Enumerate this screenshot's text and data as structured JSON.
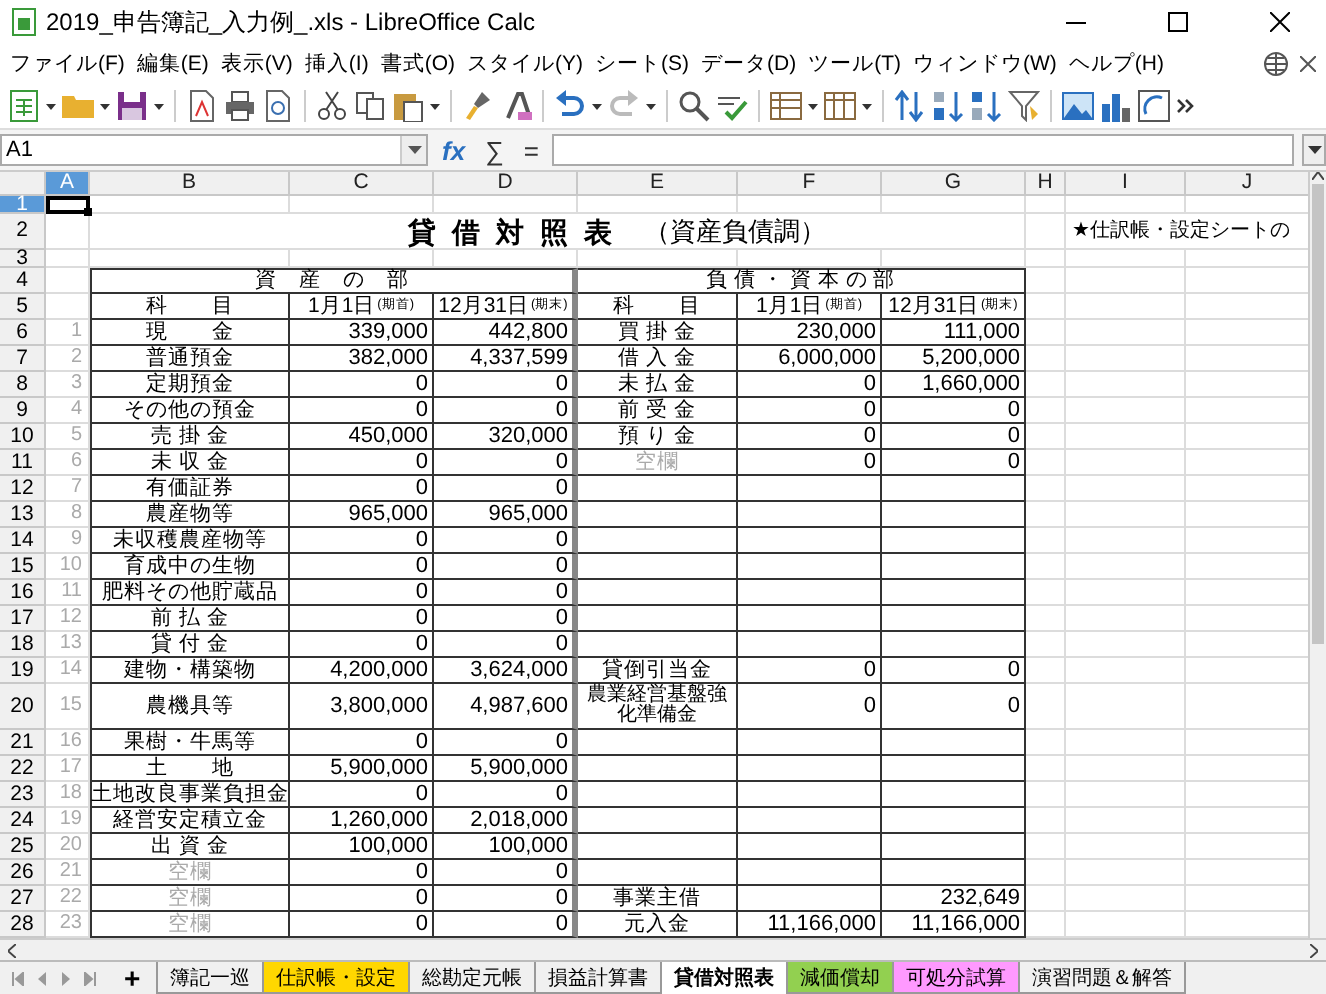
{
  "window": {
    "title": "2019_申告簿記_入力例_.xls - LibreOffice Calc"
  },
  "menu": [
    "ファイル(F)",
    "編集(E)",
    "表示(V)",
    "挿入(I)",
    "書式(O)",
    "スタイル(Y)",
    "シート(S)",
    "データ(D)",
    "ツール(T)",
    "ウィンドウ(W)",
    "ヘルプ(H)"
  ],
  "formula_bar": {
    "cell_ref": "A1",
    "symbols": [
      "fx",
      "∑",
      "="
    ]
  },
  "columns": [
    {
      "label": "A",
      "selected": true
    },
    {
      "label": "B",
      "selected": false
    },
    {
      "label": "C",
      "selected": false
    },
    {
      "label": "D",
      "selected": false
    },
    {
      "label": "E",
      "selected": false
    },
    {
      "label": "F",
      "selected": false
    },
    {
      "label": "G",
      "selected": false
    },
    {
      "label": "H",
      "selected": false
    },
    {
      "label": "I",
      "selected": false
    },
    {
      "label": "J",
      "selected": false
    }
  ],
  "rows": [
    {
      "kind": "blank",
      "row": "1",
      "selected": true
    },
    {
      "kind": "title",
      "row": "2",
      "selected": false,
      "title": "貸 借 対 照 表",
      "subtitle": "（資産負債調）",
      "note": "★仕訳帳・設定シートの"
    },
    {
      "kind": "blank",
      "row": "3",
      "selected": false
    },
    {
      "kind": "section",
      "row": "4",
      "selected": false,
      "assets": "資　産　の　部",
      "liabilities": "負 債 ・ 資 本 の 部"
    },
    {
      "kind": "header",
      "row": "5",
      "selected": false,
      "headers": [
        {
          "label": "科　　目"
        },
        {
          "label": "1月1日",
          "note": "(期首)"
        },
        {
          "label": "12月31日",
          "note": "(期末)"
        },
        {
          "label": "科　　目"
        },
        {
          "label": "1月1日",
          "note": "(期首)"
        },
        {
          "label": "12月31日",
          "note": "(期末)"
        }
      ]
    },
    {
      "kind": "entry",
      "row": "6",
      "selected": false,
      "index": "1",
      "asset": {
        "label": "現　　金",
        "muted": false
      },
      "opening": "339,000",
      "closing": "442,800",
      "liability": {
        "label": "買 掛 金",
        "muted": false
      },
      "liability_opening": "230,000",
      "liability_closing": "111,000"
    },
    {
      "kind": "entry",
      "row": "7",
      "selected": false,
      "index": "2",
      "asset": {
        "label": "普通預金",
        "muted": false
      },
      "opening": "382,000",
      "closing": "4,337,599",
      "liability": {
        "label": "借 入 金",
        "muted": false
      },
      "liability_opening": "6,000,000",
      "liability_closing": "5,200,000"
    },
    {
      "kind": "entry",
      "row": "8",
      "selected": false,
      "index": "3",
      "asset": {
        "label": "定期預金",
        "muted": false
      },
      "opening": "0",
      "closing": "0",
      "liability": {
        "label": "未 払 金",
        "muted": false
      },
      "liability_opening": "0",
      "liability_closing": "1,660,000"
    },
    {
      "kind": "entry",
      "row": "9",
      "selected": false,
      "index": "4",
      "asset": {
        "label": "その他の預金",
        "muted": false
      },
      "opening": "0",
      "closing": "0",
      "liability": {
        "label": "前 受 金",
        "muted": false
      },
      "liability_opening": "0",
      "liability_closing": "0"
    },
    {
      "kind": "entry",
      "row": "10",
      "selected": false,
      "index": "5",
      "asset": {
        "label": "売 掛 金",
        "muted": false
      },
      "opening": "450,000",
      "closing": "320,000",
      "liability": {
        "label": "預 り 金",
        "muted": false
      },
      "liability_opening": "0",
      "liability_closing": "0"
    },
    {
      "kind": "entry",
      "row": "11",
      "selected": false,
      "index": "6",
      "asset": {
        "label": "未 収 金",
        "muted": false
      },
      "opening": "0",
      "closing": "0",
      "liability": {
        "label": "空欄",
        "muted": true
      },
      "liability_opening": "0",
      "liability_closing": "0"
    },
    {
      "kind": "entry",
      "row": "12",
      "selected": false,
      "index": "7",
      "asset": {
        "label": "有価証券",
        "muted": false
      },
      "opening": "0",
      "closing": "0"
    },
    {
      "kind": "entry",
      "row": "13",
      "selected": false,
      "index": "8",
      "asset": {
        "label": "農産物等",
        "muted": false
      },
      "opening": "965,000",
      "closing": "965,000"
    },
    {
      "kind": "entry",
      "row": "14",
      "selected": false,
      "index": "9",
      "asset": {
        "label": "未収穫農産物等",
        "muted": false
      },
      "opening": "0",
      "closing": "0"
    },
    {
      "kind": "entry",
      "row": "15",
      "selected": false,
      "index": "10",
      "asset": {
        "label": "育成中の生物",
        "muted": false
      },
      "opening": "0",
      "closing": "0"
    },
    {
      "kind": "entry",
      "row": "16",
      "selected": false,
      "index": "11",
      "asset": {
        "label": "肥料その他貯蔵品",
        "muted": false
      },
      "opening": "0",
      "closing": "0"
    },
    {
      "kind": "entry",
      "row": "17",
      "selected": false,
      "index": "12",
      "asset": {
        "label": "前 払 金",
        "muted": false
      },
      "opening": "0",
      "closing": "0"
    },
    {
      "kind": "entry",
      "row": "18",
      "selected": false,
      "index": "13",
      "asset": {
        "label": "貸 付 金",
        "muted": false
      },
      "opening": "0",
      "closing": "0"
    },
    {
      "kind": "entry",
      "row": "19",
      "selected": false,
      "index": "14",
      "asset": {
        "label": "建物・構築物",
        "muted": false
      },
      "opening": "4,200,000",
      "closing": "3,624,000",
      "liability": {
        "label": "貸倒引当金",
        "muted": false
      },
      "liability_opening": "0",
      "liability_closing": "0"
    },
    {
      "kind": "entry",
      "row": "20",
      "selected": false,
      "index": "15",
      "asset": {
        "label": "農機具等",
        "muted": false
      },
      "opening": "3,800,000",
      "closing": "4,987,600",
      "liability": {
        "label": "農業経営基盤強化準備金",
        "muted": false
      },
      "liability_opening": "0",
      "liability_closing": "0"
    },
    {
      "kind": "entry",
      "row": "21",
      "selected": false,
      "index": "16",
      "asset": {
        "label": "果樹・牛馬等",
        "muted": false
      },
      "opening": "0",
      "closing": "0"
    },
    {
      "kind": "entry",
      "row": "22",
      "selected": false,
      "index": "17",
      "asset": {
        "label": "土　　地",
        "muted": false
      },
      "opening": "5,900,000",
      "closing": "5,900,000"
    },
    {
      "kind": "entry",
      "row": "23",
      "selected": false,
      "index": "18",
      "asset": {
        "label": "土地改良事業負担金",
        "muted": false
      },
      "opening": "0",
      "closing": "0"
    },
    {
      "kind": "entry",
      "row": "24",
      "selected": false,
      "index": "19",
      "asset": {
        "label": "経営安定積立金",
        "muted": false
      },
      "opening": "1,260,000",
      "closing": "2,018,000"
    },
    {
      "kind": "entry",
      "row": "25",
      "selected": false,
      "index": "20",
      "asset": {
        "label": "出 資 金",
        "muted": false
      },
      "opening": "100,000",
      "closing": "100,000"
    },
    {
      "kind": "entry",
      "row": "26",
      "selected": false,
      "index": "21",
      "asset": {
        "label": "空欄",
        "muted": true
      },
      "opening": "0",
      "closing": "0"
    },
    {
      "kind": "entry",
      "row": "27",
      "selected": false,
      "index": "22",
      "asset": {
        "label": "空欄",
        "muted": true
      },
      "opening": "0",
      "closing": "0",
      "liability": {
        "label": "事業主借",
        "muted": false
      },
      "liability_closing": "232,649"
    },
    {
      "kind": "entry",
      "row": "28",
      "selected": false,
      "index": "23",
      "asset": {
        "label": "空欄",
        "muted": true
      },
      "opening": "0",
      "closing": "0",
      "liability": {
        "label": "元入金",
        "muted": false
      },
      "liability_opening": "11,166,000",
      "liability_closing": "11,166,000"
    }
  ],
  "sheet_tabs": {
    "add": "+",
    "tabs": [
      {
        "label": "簿記一巡",
        "selected": false
      },
      {
        "label": "仕訳帳・設定",
        "selected": false,
        "color": "#ffd700"
      },
      {
        "label": "総勘定元帳",
        "selected": false
      },
      {
        "label": "損益計算書",
        "selected": false
      },
      {
        "label": "貸借対照表",
        "selected": true
      },
      {
        "label": "減価償却",
        "selected": false,
        "color": "#92d050"
      },
      {
        "label": "可処分試算",
        "selected": false,
        "color": "#ff99ff"
      },
      {
        "label": "演習問題＆解答",
        "selected": false
      }
    ]
  }
}
